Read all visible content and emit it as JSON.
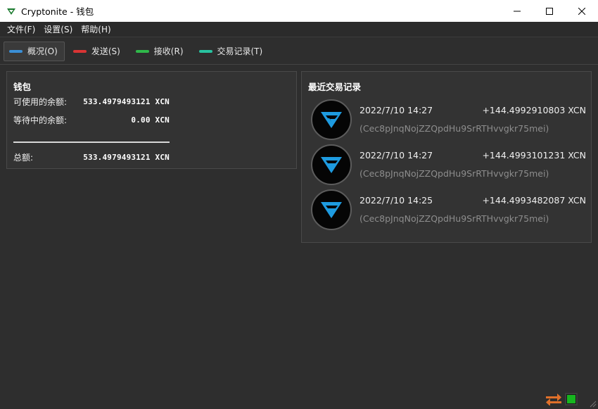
{
  "window": {
    "title": "Cryptonite - 钱包",
    "controls": [
      "minimize-icon",
      "maximize-icon",
      "close-icon"
    ]
  },
  "menu": {
    "items": [
      "文件(F)",
      "设置(S)",
      "帮助(H)"
    ]
  },
  "toolbar": {
    "tabs": [
      {
        "label": "概况(O)",
        "color": "#3a8fd6",
        "active": true
      },
      {
        "label": "发送(S)",
        "color": "#d93434",
        "active": false
      },
      {
        "label": "接收(R)",
        "color": "#2fb84a",
        "active": false
      },
      {
        "label": "交易记录(T)",
        "color": "#28c2a0",
        "active": false
      }
    ]
  },
  "wallet": {
    "title": "钱包",
    "available_label": "可使用的余额:",
    "available_value": "533.4979493121 XCN",
    "pending_label": "等待中的余额:",
    "pending_value": "0.00 XCN",
    "total_label": "总额:",
    "total_value": "533.4979493121 XCN"
  },
  "recent": {
    "title": "最近交易记录",
    "transactions": [
      {
        "date": "2022/7/10 14:27",
        "amount": "+144.4992910803 XCN",
        "address": "(Cec8pJnqNojZZQpdHu9SrRTHvvgkr75mei)"
      },
      {
        "date": "2022/7/10 14:27",
        "amount": "+144.4993101231 XCN",
        "address": "(Cec8pJnqNojZZQpdHu9SrRTHvvgkr75mei)"
      },
      {
        "date": "2022/7/10 14:25",
        "amount": "+144.4993482087 XCN",
        "address": "(Cec8pJnqNojZZQpdHu9SrRTHvvgkr75mei)"
      }
    ]
  },
  "status": {
    "icons": [
      "sync-arrows-icon",
      "network-connected-icon"
    ]
  },
  "colors": {
    "accent_logo": "#1e9be0",
    "connected": "#17b51f",
    "sync": "#e0702a"
  }
}
